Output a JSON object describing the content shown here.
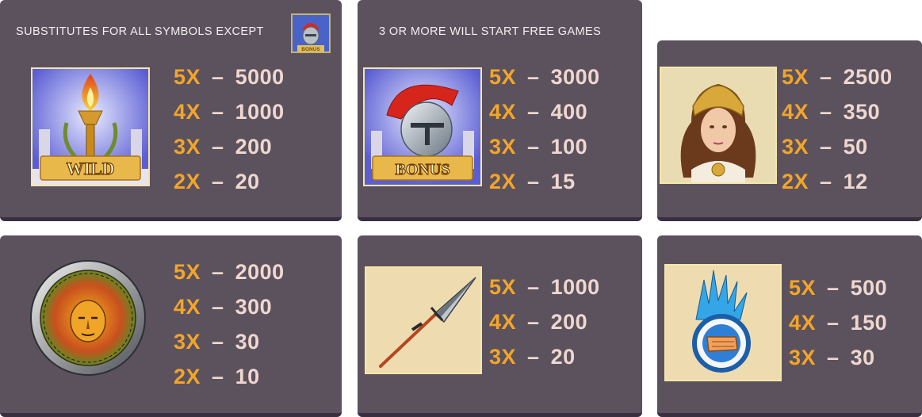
{
  "wild": {
    "caption": "SUBSTITUTES FOR ALL SYMBOLS EXCEPT",
    "symbol_label": "WILD",
    "except_icon_label": "BONUS",
    "payouts": [
      {
        "mult": "5X",
        "amount": "5000"
      },
      {
        "mult": "4X",
        "amount": "1000"
      },
      {
        "mult": "3X",
        "amount": "200"
      },
      {
        "mult": "2X",
        "amount": "20"
      }
    ]
  },
  "bonus": {
    "caption": "3 OR MORE WILL START FREE GAMES",
    "symbol_label": "BONUS",
    "payouts": [
      {
        "mult": "5X",
        "amount": "3000"
      },
      {
        "mult": "4X",
        "amount": "400"
      },
      {
        "mult": "3X",
        "amount": "100"
      },
      {
        "mult": "2X",
        "amount": "15"
      }
    ]
  },
  "goddess": {
    "payouts": [
      {
        "mult": "5X",
        "amount": "2500"
      },
      {
        "mult": "4X",
        "amount": "350"
      },
      {
        "mult": "3X",
        "amount": "50"
      },
      {
        "mult": "2X",
        "amount": "12"
      }
    ]
  },
  "medusa_shield": {
    "payouts": [
      {
        "mult": "5X",
        "amount": "2000"
      },
      {
        "mult": "4X",
        "amount": "300"
      },
      {
        "mult": "3X",
        "amount": "30"
      },
      {
        "mult": "2X",
        "amount": "10"
      }
    ]
  },
  "spear": {
    "payouts": [
      {
        "mult": "5X",
        "amount": "1000"
      },
      {
        "mult": "4X",
        "amount": "200"
      },
      {
        "mult": "3X",
        "amount": "20"
      }
    ]
  },
  "lightning": {
    "payouts": [
      {
        "mult": "5X",
        "amount": "500"
      },
      {
        "mult": "4X",
        "amount": "150"
      },
      {
        "mult": "3X",
        "amount": "30"
      }
    ]
  },
  "colors": {
    "panel": "#5b525e",
    "multiplier": "#f3a52a",
    "amount": "#efd7cf",
    "caption": "#f2eef0"
  }
}
